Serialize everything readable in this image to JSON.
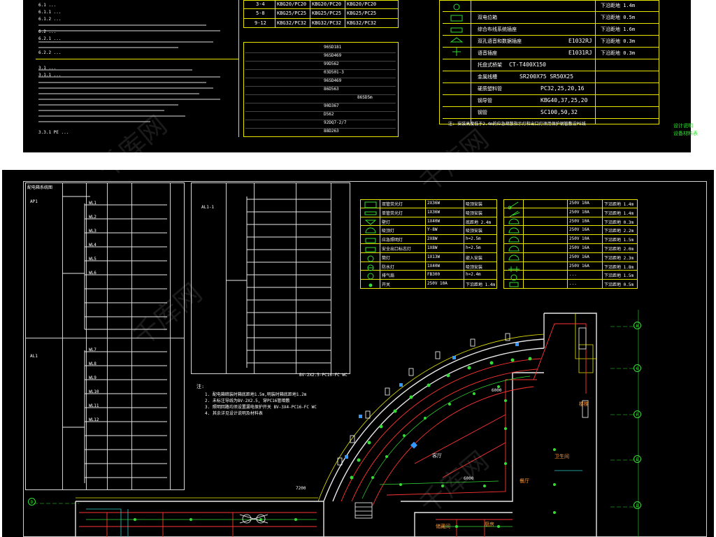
{
  "top_sheet": {
    "notes_left": [
      "6.1 ...",
      "6.1.1 ...",
      "6.1.2 ...",
      "6.2 ...",
      "6.2.1 ...",
      "6.2.2 ...",
      "3.1 ...",
      "3.1.1 ...",
      "3.3.1 PE ..."
    ],
    "pipe_table": {
      "rows": [
        {
          "range": "3-4",
          "a": "KBG20/PC20",
          "b": "KBG20/PC20",
          "c": "KBG20/PC20"
        },
        {
          "range": "5-8",
          "a": "KBG25/PC25",
          "b": "KBG25/PC25",
          "c": "KBG25/PC25"
        },
        {
          "range": "9-12",
          "a": "KBG32/PC32",
          "b": "KBG32/PC32",
          "c": "KBG32/PC32"
        }
      ]
    },
    "standards_codes": [
      "96SD181",
      "96SD469",
      "99D562",
      "03D501-3",
      "96SD469",
      "86D563",
      "86SD5m",
      "90D367",
      "D562",
      "92DQ7-2/7",
      "88D263"
    ],
    "material_table": {
      "rows": [
        {
          "name": "...",
          "spec": "...",
          "note": "下沿距地 1.4m"
        },
        {
          "name": "双电位箱",
          "spec": "...",
          "note": "下沿距地 0.5m"
        },
        {
          "name": "综合布线系统插座",
          "spec": "...",
          "note": "下沿距地 1.6m"
        },
        {
          "name": "双孔语音和数据插座",
          "spec": "E1032RJ",
          "note": "下沿距地 0.3m"
        },
        {
          "name": "语音插座",
          "spec": "E1031RJ",
          "note": "下沿距地 0.3m"
        },
        {
          "name": "托盘式桥架",
          "spec": "CT-T400X150",
          "note": ""
        },
        {
          "name": "金属线槽",
          "spec": "SR200X75  SR50X25",
          "note": ""
        },
        {
          "name": "硬质塑料管",
          "spec": "PC32,25,20,16",
          "note": ""
        },
        {
          "name": "钢导管",
          "spec": "KBG40,37,25,20",
          "note": ""
        },
        {
          "name": "钢管",
          "spec": "SC100,50,32",
          "note": ""
        }
      ],
      "footnote": "注: 安装高度低于2.4m的应急疏散指示灯和出口灯须用保护钢管敷设PE线"
    },
    "side_labels": [
      "设计说明",
      "设备材料表"
    ]
  },
  "main_sheet": {
    "panel_schedule_left_title": "配电箱系统图",
    "panel_ids": [
      "AP1",
      "AL1",
      "AL1-1"
    ],
    "circuit_codes": [
      "WL1",
      "WL2",
      "WL3",
      "WL4",
      "WL5",
      "WL6",
      "WL7",
      "WL8",
      "WL9",
      "WL10",
      "WL11",
      "WL12"
    ],
    "cable_spec": "BV-2X2.5-PC16-FC WC",
    "notes_title": "注:",
    "notes": [
      "1. 配电箱暗装时箱底距地1.5m,明装时箱底距地1.2m",
      "2. 未标注导线为BV-2X2.5, 穿PC16管暗敷",
      "3. 照明回路均须设置漏电保护开关 BV-3X4-PC16-FC WC",
      "4. 其余详见设计说明及材料表"
    ],
    "legend_left": [
      {
        "sym": "grid-panel",
        "name": "双管荧光灯",
        "spec": "2X36W",
        "mount": "吸顶安装"
      },
      {
        "sym": "rect",
        "name": "单管荧光灯",
        "spec": "1X36W",
        "mount": "吸顶安装"
      },
      {
        "sym": "bracket",
        "name": "壁灯",
        "spec": "1X40W",
        "mount": "底距地 2.4m"
      },
      {
        "sym": "half-circle",
        "name": "吸顶灯",
        "spec": "Y-8W",
        "mount": "吸顶安装"
      },
      {
        "sym": "emergency",
        "name": "应急照明灯",
        "spec": "2X8W",
        "mount": "h=2.5m"
      },
      {
        "sym": "exit",
        "name": "安全出口标志灯",
        "spec": "1X8W",
        "mount": "h=2.5m"
      },
      {
        "sym": "circle",
        "name": "筒灯",
        "spec": "1X13W",
        "mount": "嵌入安装"
      },
      {
        "sym": "cross-circle",
        "name": "防水灯",
        "spec": "1X40W",
        "mount": "吸顶安装"
      },
      {
        "sym": "fan",
        "name": "排气扇",
        "spec": "FB300",
        "mount": "h=2.4m"
      },
      {
        "sym": "dot",
        "name": "开关",
        "spec": "250V 10A",
        "mount": "下沿距地 1.4m"
      }
    ],
    "legend_right": [
      {
        "sym": "switch1",
        "spec": "250V 10A",
        "mount": "下沿距地 1.4m"
      },
      {
        "sym": "switch2",
        "spec": "250V 10A",
        "mount": "下沿距地 1.4m"
      },
      {
        "sym": "socket",
        "spec": "250V 10A",
        "mount": "下沿距地 0.3m"
      },
      {
        "sym": "socket-ac",
        "spec": "250V 16A",
        "mount": "下沿距地 2.2m"
      },
      {
        "sym": "socket-wp",
        "spec": "250V 10A",
        "mount": "下沿距地 1.5m"
      },
      {
        "sym": "socket-k",
        "spec": "250V 16A",
        "mount": "下沿距地 2.0m"
      },
      {
        "sym": "socket-h",
        "spec": "250V 16A",
        "mount": "下沿距地 2.3m"
      },
      {
        "sym": "socket-f",
        "spec": "250V 16A",
        "mount": "下沿距地 1.8m"
      },
      {
        "sym": "panel",
        "spec": "...",
        "mount": "下沿距地 1.5m"
      },
      {
        "sym": "panel2",
        "spec": "...",
        "mount": "下沿距地 0.5m"
      }
    ],
    "grid_axes_right": [
      "H",
      "G",
      "F",
      "E",
      "D"
    ],
    "grid_axes_left": [
      "D"
    ],
    "room_labels": [
      "客厅",
      "餐厅",
      "楼梯",
      "厨房",
      "卫生间",
      "储藏间"
    ],
    "dimension_labels": [
      "6000",
      "6000",
      "7200"
    ]
  },
  "watermark_text": "千库网"
}
